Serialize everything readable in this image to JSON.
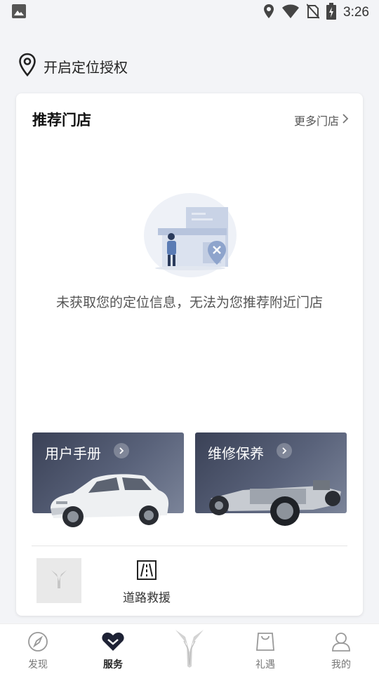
{
  "status_bar": {
    "time": "3:26",
    "icons": [
      "gallery-icon",
      "location-icon",
      "wifi-icon",
      "no-sim-icon",
      "battery-charging-icon"
    ]
  },
  "location": {
    "label": "开启定位授权",
    "icon": "map-pin-icon"
  },
  "store_card": {
    "title": "推荐门店",
    "more_label": "更多门店",
    "empty_message": "未获取您的定位信息，无法为您推荐附近门店"
  },
  "tiles": [
    {
      "label": "用户手册",
      "icon": "chevron-right-icon"
    },
    {
      "label": "维修保养",
      "icon": "chevron-right-icon"
    }
  ],
  "services": {
    "roadside_label": "道路救援",
    "roadside_icon": "road-icon"
  },
  "tab_bar": {
    "items": [
      {
        "label": "发现",
        "icon": "compass-icon",
        "active": false
      },
      {
        "label": "服务",
        "icon": "heart-chevron-icon",
        "active": true
      },
      {
        "label": "",
        "icon": "brand-logo-icon",
        "active": false
      },
      {
        "label": "礼遇",
        "icon": "gift-bag-icon",
        "active": false
      },
      {
        "label": "我的",
        "icon": "user-icon",
        "active": false
      }
    ]
  },
  "colors": {
    "background": "#f3f4f7",
    "card": "#ffffff",
    "tile_dark": "#3a4156",
    "active_tab": "#222222",
    "inactive_tab": "#777777"
  }
}
